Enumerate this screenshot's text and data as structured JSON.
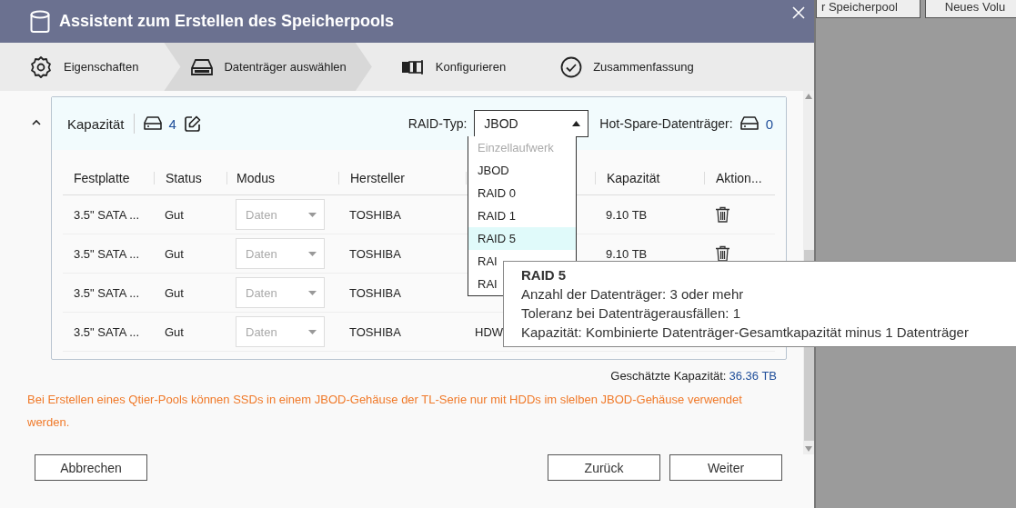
{
  "background_buttons": [
    "r Speicherpool",
    "Neues Volu"
  ],
  "window": {
    "title": "Assistent zum Erstellen des Speicherpools"
  },
  "steps": [
    {
      "label": "Eigenschaften",
      "selected": false
    },
    {
      "label": "Datenträger auswählen",
      "selected": true
    },
    {
      "label": "Konfigurieren",
      "selected": false
    },
    {
      "label": "Zusammenfassung",
      "selected": false
    }
  ],
  "group": {
    "title": "Kapazität",
    "disk_count": "4",
    "expanded": true,
    "raid_label": "RAID-Typ:",
    "raid_value": "JBOD",
    "spare_label": "Hot-Spare-Datenträger:",
    "spare_count": "0"
  },
  "raid_options": [
    {
      "label": "Einzellaufwerk",
      "disabled": true,
      "selected": false
    },
    {
      "label": "JBOD",
      "disabled": false,
      "selected": false
    },
    {
      "label": "RAID 0",
      "disabled": false,
      "selected": false
    },
    {
      "label": "RAID 1",
      "disabled": false,
      "selected": false
    },
    {
      "label": "RAID 5",
      "disabled": false,
      "selected": true
    },
    {
      "label": "RAI",
      "disabled": false,
      "selected": false
    },
    {
      "label": "RAI",
      "disabled": false,
      "selected": false
    }
  ],
  "table": {
    "columns": [
      "Festplatte",
      "Status",
      "Modus",
      "Hersteller",
      "Kapazität",
      "Aktion..."
    ],
    "rows": [
      {
        "disk": "3.5\" SATA ...",
        "status": "Gut",
        "mode": "Daten",
        "vendor": "TOSHIBA",
        "capacity": "9.10 TB",
        "deletable": true
      },
      {
        "disk": "3.5\" SATA ...",
        "status": "Gut",
        "mode": "Daten",
        "vendor": "TOSHIBA",
        "capacity": "9.10 TB",
        "deletable": true
      },
      {
        "disk": "3.5\" SATA ...",
        "status": "Gut",
        "mode": "Daten",
        "vendor": "TOSHIBA"
      },
      {
        "disk": "3.5\" SATA ...",
        "status": "Gut",
        "mode": "Daten",
        "vendor": "TOSHIBA",
        "column_5": "HDW"
      }
    ]
  },
  "tooltip": {
    "title": "RAID 5",
    "lines": [
      "Anzahl der Datenträger: 3 oder mehr",
      "Toleranz bei Datenträgerausfällen: 1",
      "Kapazität: Kombinierte Datenträger-Gesamtkapazität minus 1 Datenträger"
    ]
  },
  "estimate": {
    "label": "Geschätzte Kapazität:",
    "value": "36.36 TB"
  },
  "warning": "Bei Erstellen eines Qtier-Pools können SSDs in einem JBOD-Gehäuse der TL-Serie nur mit HDDs im slelben JBOD-Gehäuse verwendet werden.",
  "buttons": {
    "cancel": "Abbrechen",
    "back": "Zurück",
    "next": "Weiter"
  }
}
